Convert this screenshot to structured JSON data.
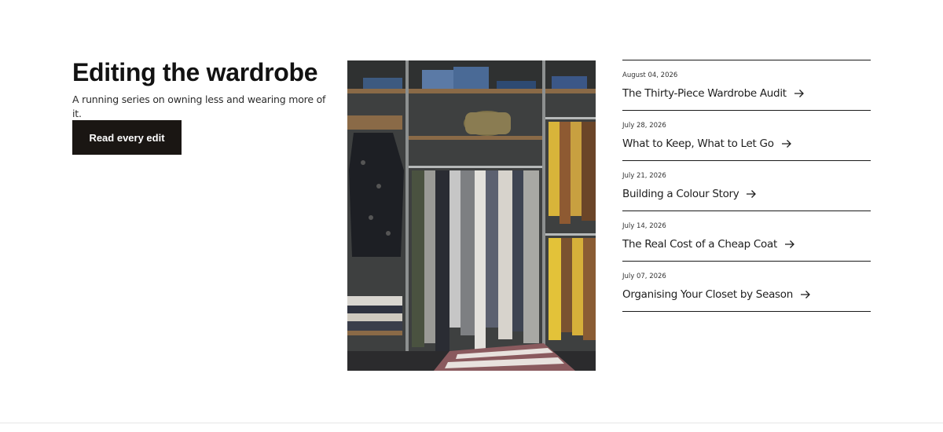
{
  "intro": {
    "title": "Editing the wardrobe",
    "subtitle": "A running series on owning less and wearing more of it.",
    "cta_label": "Read every edit"
  },
  "image": {
    "description": "Open closet with clothes on hangers, folded denim and sweaters on shelves"
  },
  "posts": [
    {
      "date": "August 04, 2026",
      "title": "The Thirty-Piece Wardrobe Audit",
      "icon": "arrow-right-icon"
    },
    {
      "date": "July 28, 2026",
      "title": "What to Keep, What to Let Go",
      "icon": "arrow-right-icon"
    },
    {
      "date": "July 21, 2026",
      "title": "Building a Colour Story",
      "icon": "arrow-right-icon"
    },
    {
      "date": "July 14, 2026",
      "title": "The Real Cost of a Cheap Coat",
      "icon": "arrow-right-icon"
    },
    {
      "date": "July 07, 2026",
      "title": "Organising Your Closet by Season",
      "icon": "arrow-right-icon"
    }
  ],
  "colors": {
    "text": "#121212",
    "button_bg": "#1a1613",
    "button_text": "#ffffff",
    "divider": "#1a1a1a"
  }
}
